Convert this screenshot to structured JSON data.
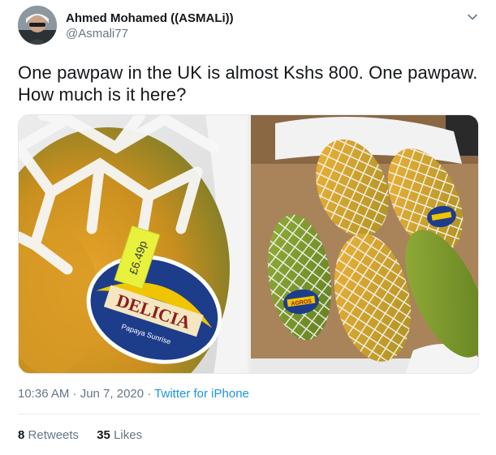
{
  "tweet": {
    "author_name": "Ahmed Mohamed ((ASMALi))",
    "author_handle": "@Asmali77",
    "text": "One pawpaw in the UK is almost Kshs 800. One pawpaw. How much is it here?",
    "timestamp": "10:36 AM · Jun 7, 2020",
    "separator": " · ",
    "source": "Twitter for iPhone",
    "retweets_count": "8",
    "retweets_label": "Retweets",
    "likes_count": "35",
    "likes_label": "Likes"
  },
  "media": {
    "left_photo": {
      "price_tag": "£6.49p",
      "brand_label": "DELICIA",
      "sub_label": "Papaya Sunrise"
    },
    "right_photo": {
      "brand_label": "AGROS"
    }
  },
  "colors": {
    "link": "#1b95e0",
    "secondary": "#657786",
    "primary_text": "#14171a"
  },
  "icons": [
    "avatar",
    "chevron-down-icon"
  ]
}
